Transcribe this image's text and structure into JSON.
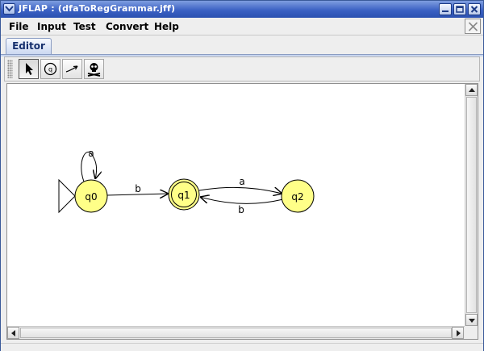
{
  "window": {
    "title": "JFLAP : (dfaToRegGrammar.jff)"
  },
  "menu": {
    "items": [
      "File",
      "Input",
      "Test",
      "Convert",
      "Help"
    ]
  },
  "tabs": [
    {
      "label": "Editor",
      "selected": true
    }
  ],
  "toolbar": {
    "tools": [
      {
        "name": "attribute-editor-tool",
        "icon": "pointer-arrow-icon",
        "active": true
      },
      {
        "name": "state-creator-tool",
        "icon": "state-circle-icon",
        "active": false
      },
      {
        "name": "transition-creator-tool",
        "icon": "transition-arrow-icon",
        "active": false
      },
      {
        "name": "deleter-tool",
        "icon": "skull-crossbones-icon",
        "active": false
      }
    ]
  },
  "automaton": {
    "states": [
      {
        "id": "q0",
        "label": "q0",
        "initial": true,
        "final": false
      },
      {
        "id": "q1",
        "label": "q1",
        "initial": false,
        "final": true
      },
      {
        "id": "q2",
        "label": "q2",
        "initial": false,
        "final": false
      }
    ],
    "transitions": [
      {
        "from": "q0",
        "to": "q0",
        "symbol": "a"
      },
      {
        "from": "q0",
        "to": "q1",
        "symbol": "b"
      },
      {
        "from": "q1",
        "to": "q2",
        "symbol": "a"
      },
      {
        "from": "q2",
        "to": "q1",
        "symbol": "b"
      }
    ]
  },
  "colors": {
    "state_fill": "#ffff88",
    "title_bar": "#3c62c4"
  }
}
